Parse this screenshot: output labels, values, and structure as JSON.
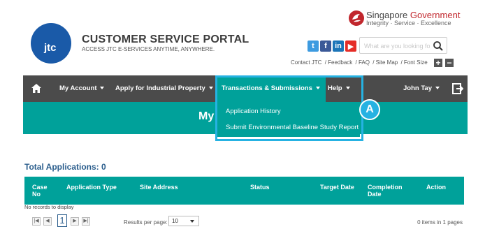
{
  "header": {
    "portal_title": "CUSTOMER SERVICE PORTAL",
    "portal_tagline": "ACCESS JTC E-SERVICES ANYTIME, ANYWHERE.",
    "logo_text": "jtc",
    "sg_gov_name_1": "Singapore",
    "sg_gov_name_2": "Government",
    "sg_gov_sub": "Integrity · Service · Excellence",
    "search_placeholder": "What are you looking fo",
    "links": [
      "Contact JTC",
      "/ Feedback",
      "/ FAQ",
      "/ Site Map",
      "/ Font Size"
    ],
    "font_plus": "+",
    "font_minus": "−",
    "social": [
      "twitter-icon",
      "facebook-icon",
      "linkedin-icon",
      "youtube-icon"
    ]
  },
  "nav": {
    "account": "My Account",
    "apply": "Apply for Industrial Property",
    "transactions": "Transactions & Submissions",
    "help": "Help",
    "user": "John Tay"
  },
  "dropdown": {
    "item1": "Application History",
    "item2": "Submit Environmental Baseline Study Report"
  },
  "callout_badge": "A",
  "banner_title": "My",
  "main": {
    "total_label": "Total Applications: 0",
    "columns": {
      "case_no_1": "Case",
      "case_no_2": "No",
      "type": "Application Type",
      "site": "Site Address",
      "status": "Status",
      "target": "Target Date",
      "completion_1": "Completion",
      "completion_2": "Date",
      "action": "Action"
    },
    "no_records": "No records to display",
    "pager": {
      "current_page": "1",
      "results_label": "Results per page:",
      "results_value": "10",
      "items_info": "0 items in 1 pages"
    }
  },
  "colors": {
    "teal": "#00a19a",
    "nav_dark": "#4b4b4b",
    "highlight": "#26b2e2",
    "title_blue": "#2a5d8c"
  }
}
